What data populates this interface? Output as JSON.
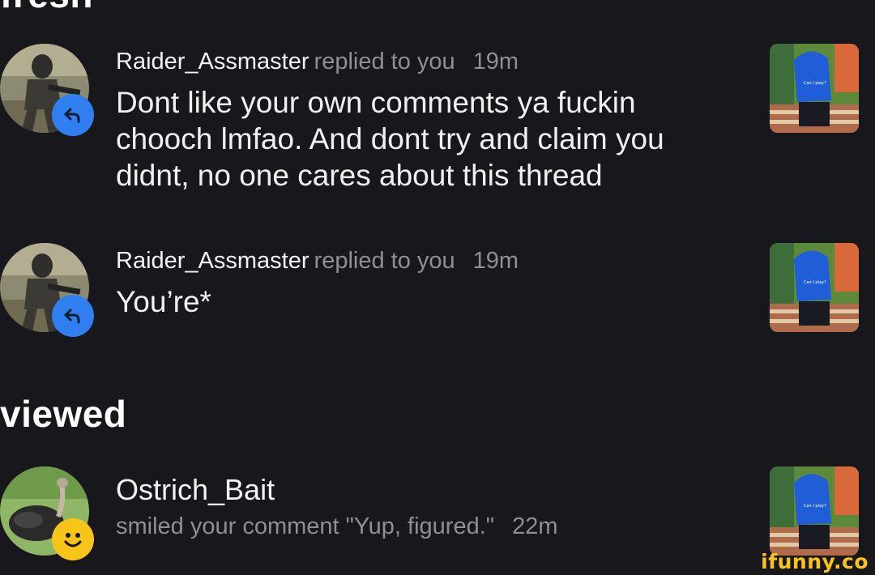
{
  "sections": {
    "fresh_title": "fresh",
    "viewed_title": "viewed"
  },
  "notifications": [
    {
      "username": "Raider_Assmaster",
      "action": "replied to you",
      "time": "19m",
      "body": "Dont like your own comments ya fuckin chooch lmfao. And dont try and claim you didnt, no one cares about this thread",
      "badge_icon": "reply-icon",
      "avatar": "soldier-avatar"
    },
    {
      "username": "Raider_Assmaster",
      "action": "replied to you",
      "time": "19m",
      "body": "You’re*",
      "badge_icon": "reply-icon",
      "avatar": "soldier-avatar"
    },
    {
      "username": "Ostrich_Bait",
      "action": "smiled your comment \"Yup, figured.\"",
      "time": "22m",
      "badge_icon": "smile-icon",
      "avatar": "ostrich-avatar"
    }
  ],
  "thumbnail_caption": "Can I play?",
  "watermark": "ifunny.co",
  "colors": {
    "background": "#18171b",
    "reply_badge": "#2f7ff0",
    "smile_badge": "#f7c51a",
    "muted_text": "#8f8f94",
    "watermark": "#f7c51a"
  }
}
